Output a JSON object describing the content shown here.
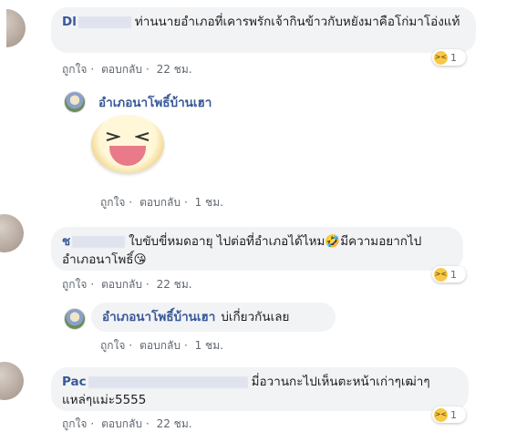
{
  "comments": [
    {
      "author": "Dl",
      "text": "ท่านนายอำเภอที่เคารพรักเจ้ากินข้าวกับหยังมาคือโก่มาโอ่งแท้",
      "like": "ถูกใจ",
      "reply": "ตอบกลับ",
      "time": "22 ชม.",
      "reaction_count": "1"
    },
    {
      "author": "อำเภอนาโพธิ์บ้านเฮา",
      "like": "ถูกใจ",
      "reply": "ตอบกลับ",
      "time": "1 ชม."
    },
    {
      "author": "ช",
      "text": "ใบขับขี่หมดอายุ ไปต่อที่อำเภอได้ไหม🤣มีความอยากไปอำเภอนาโพธิ์😘",
      "like": "ถูกใจ",
      "reply": "ตอบกลับ",
      "time": "22 ชม.",
      "reaction_count": "1"
    },
    {
      "author": "อำเภอนาโพธิ์บ้านเฮา",
      "text": "บ่เกี่ยวกันเลย",
      "like": "ถูกใจ",
      "reply": "ตอบกลับ",
      "time": "1 ชม."
    },
    {
      "author": "Pac",
      "text": "มี่อวานกะไปเห็นตะหน้าเก่าๆเฒ่าๆแหล่ๆแม่ะ5555",
      "like": "ถูกใจ",
      "reply": "ตอบกลับ",
      "time": "22 ชม.",
      "reaction_count": "1"
    }
  ],
  "icons": {
    "reaction": "laughing-emoji-icon",
    "sticker": "laughing-sticker"
  },
  "colors": {
    "author": "#385898",
    "bubble": "#f2f3f5",
    "meta": "#606770"
  }
}
